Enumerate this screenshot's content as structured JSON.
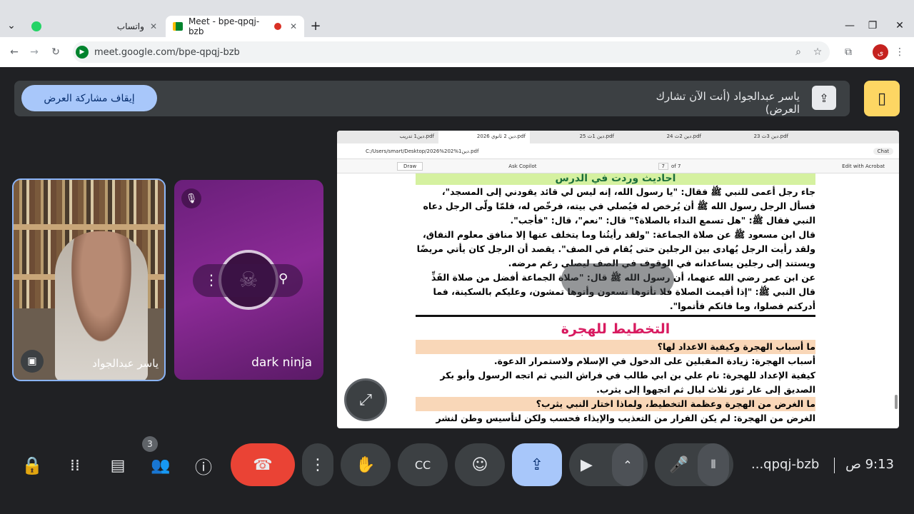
{
  "browser": {
    "tabs": [
      {
        "label": "واتساب",
        "active": false
      },
      {
        "label": "Meet - bpe-qpqj-bzb",
        "active": true
      }
    ],
    "url": "meet.google.com/bpe-qpqj-bzb",
    "profile_initial": "ی"
  },
  "share_bar": {
    "stop_label": "إيقاف مشاركة العرض",
    "status_text": "ياسر عبدالجواد (أنت الآن تشارك العرض)"
  },
  "participants": [
    {
      "name": "ياسر عبدالجواد"
    },
    {
      "name": "dark ninja",
      "muted": true
    }
  ],
  "presentation": {
    "pdf_tabs": [
      "دين 3ث 23.pdf",
      "دين 2ث 24.pdf",
      "دين 1ث 25.pdf",
      "دين 2 ثانوي 2026.pdf",
      "دين1 تدريب.pdf"
    ],
    "file_path": "C:/Users/smart/Desktop/2026%202%دين1.pdf",
    "page_current": "7",
    "page_total": "of 7",
    "draw_label": "Draw",
    "copilot_label": "Ask Copilot",
    "acrobat_label": "Edit with Acrobat",
    "chat_label": "Chat",
    "section_title": "أحاديث وردت في الدرس",
    "hadiths": [
      "جاء رجل أعمى للنبي ﷺ فقال: \"يا رسول الله، إنه ليس لي قائد يقودني إلى المسجد\"، فسأل الرجل رسول الله ﷺ أن يُرخص له فيُصلي في بيته، فرخّص له، فلمّا ولّى الرجل دعاه النبي فقال ﷺ: \"هل تسمع النداء بالصلاة؟\" قال: \"نعم\"، قال: \"فأجب\".",
      "قال ابن مسعود ﷺ عن صلاة الجماعة: \"ولقد رأيتُنا وما يتخلف عنها إلا منافق معلوم النفاق، ولقد رأيت الرجل يُهادى بين الرجلين حتى يُقام في الصف\". يقصد أن الرجل كان يأتي مريضًا ويستند إلى رجلين يساعدانه في الوقوف في الصف ليصلي رغم مرضه.",
      "عن ابن عمر رضي الله عنهما، أن رسول الله ﷺ قال: \"صلاة الجماعة أفضل من صلاة الفَذِّ بسبع وعشرين درجة\".",
      "قال النبي ﷺ: \"إذا أقيمت الصلاة فلا تأتوها تسعون وأتوها تمشون، وعليكم بالسكينة، فما أدركتم فصلوا، وما فاتكم فأتموا\"."
    ],
    "heading2": "التخطيط للهجرة",
    "q1": "ما أسباب الهجرة وكيفية الاعداد لها؟",
    "a1_1": "أسباب الهجرة: زيادة المقبلين على الدخول في الإسلام ولاستمرار الدعوة.",
    "a1_2": "كيفية الإعداد للهجرة: نام علي بن ابي طالب في فراش النبي  ثم اتجه الرسول وأبو بكر الصديق إلى غار ثور ثلاث ليال ثم اتجهوا إلى يثرب.",
    "q2": "ما الغرض من الهجرة وعظمة التخطيط، ولماذا اختار النبي يثرب؟",
    "a2_1": "الغرض من الهجرة: لم يكن الفرار من التعذيب والإيذاء فحسب ولكن لتأسيس وطن لنشر دعوة الإسلام في العالم."
  },
  "bottom_bar": {
    "meeting_code": "...qpqj-bzb",
    "time": "9:13 ص",
    "participant_count": "3"
  },
  "colors": {
    "end_call": "#ea4335",
    "active_present": "#a8c7fa",
    "stop_share": "#a8c7fa",
    "accent_yellow": "#fdd663"
  }
}
